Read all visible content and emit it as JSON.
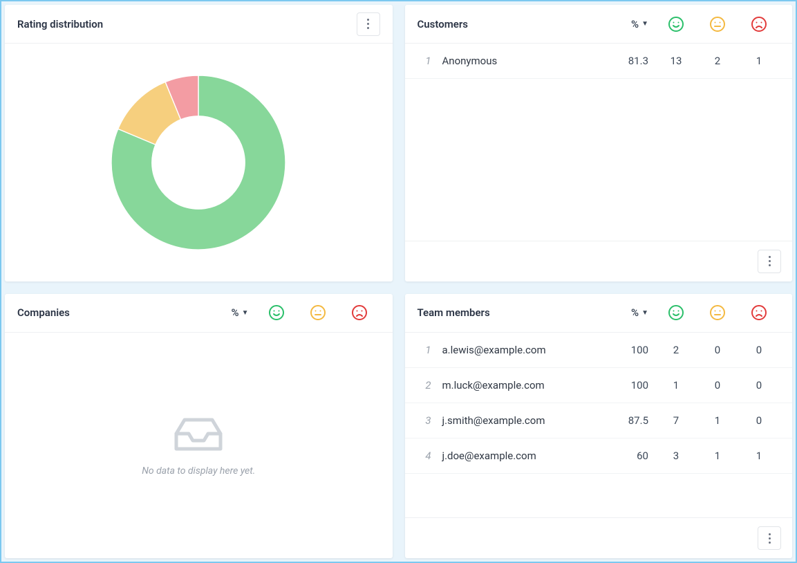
{
  "cards": {
    "rating_distribution": {
      "title": "Rating distribution"
    },
    "customers": {
      "title": "Customers",
      "percent_label": "%"
    },
    "companies": {
      "title": "Companies",
      "percent_label": "%",
      "empty_text": "No data to display here yet."
    },
    "team_members": {
      "title": "Team members",
      "percent_label": "%"
    }
  },
  "colors": {
    "good": "#2bbf6a",
    "meh": "#f4b941",
    "bad": "#e23b3b",
    "donut_good": "#87d79a",
    "donut_meh": "#f6cf7e",
    "donut_bad": "#f39ca3"
  },
  "customers_rows": [
    {
      "idx": "1",
      "name": "Anonymous",
      "pct": "81.3",
      "good": "13",
      "meh": "2",
      "bad": "1"
    }
  ],
  "team_rows": [
    {
      "idx": "1",
      "name": "a.lewis@example.com",
      "pct": "100",
      "good": "2",
      "meh": "0",
      "bad": "0"
    },
    {
      "idx": "2",
      "name": "m.luck@example.com",
      "pct": "100",
      "good": "1",
      "meh": "0",
      "bad": "0"
    },
    {
      "idx": "3",
      "name": "j.smith@example.com",
      "pct": "87.5",
      "good": "7",
      "meh": "1",
      "bad": "0"
    },
    {
      "idx": "4",
      "name": "j.doe@example.com",
      "pct": "60",
      "good": "3",
      "meh": "1",
      "bad": "1"
    }
  ],
  "chart_data": {
    "type": "pie",
    "title": "Rating distribution",
    "series": [
      {
        "name": "Good",
        "value": 13,
        "percent": 81.3,
        "color": "#87d79a"
      },
      {
        "name": "Neutral",
        "value": 2,
        "percent": 12.5,
        "color": "#f6cf7e"
      },
      {
        "name": "Bad",
        "value": 1,
        "percent": 6.2,
        "color": "#f39ca3"
      }
    ]
  }
}
